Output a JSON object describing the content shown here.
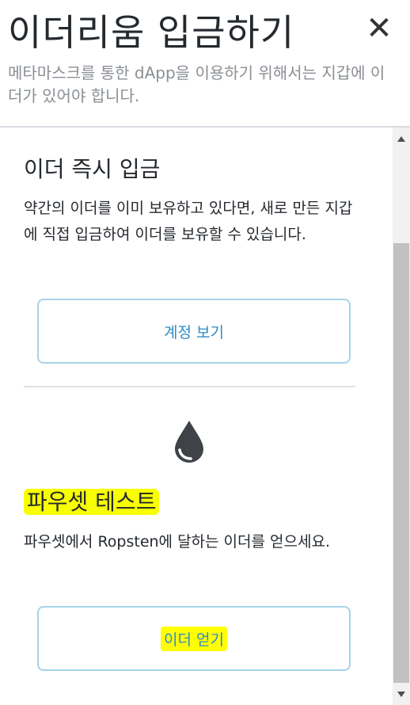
{
  "header": {
    "title": "이더리움 입금하기",
    "close_glyph": "✕",
    "subtitle": "메타마스크를 통한 dApp을 이용하기 위해서는 지갑에 이더가 있어야 합니다."
  },
  "direct_deposit": {
    "title": "이더 즉시 입금",
    "description": "약간의 이더를 이미 보유하고 있다면, 새로 만든 지갑에 직접 입금하여 이더를 보유할 수 있습니다.",
    "button_label": "계정 보기"
  },
  "faucet": {
    "icon": "droplet-icon",
    "title": "파우셋 테스트",
    "description": "파우셋에서 Ropsten에 달하는 이더를 얻으세요.",
    "button_label": "이더 얻기"
  },
  "colors": {
    "highlight": "#ffff00",
    "button_border": "#a6d3ea",
    "button_text": "#2f8bc6"
  }
}
